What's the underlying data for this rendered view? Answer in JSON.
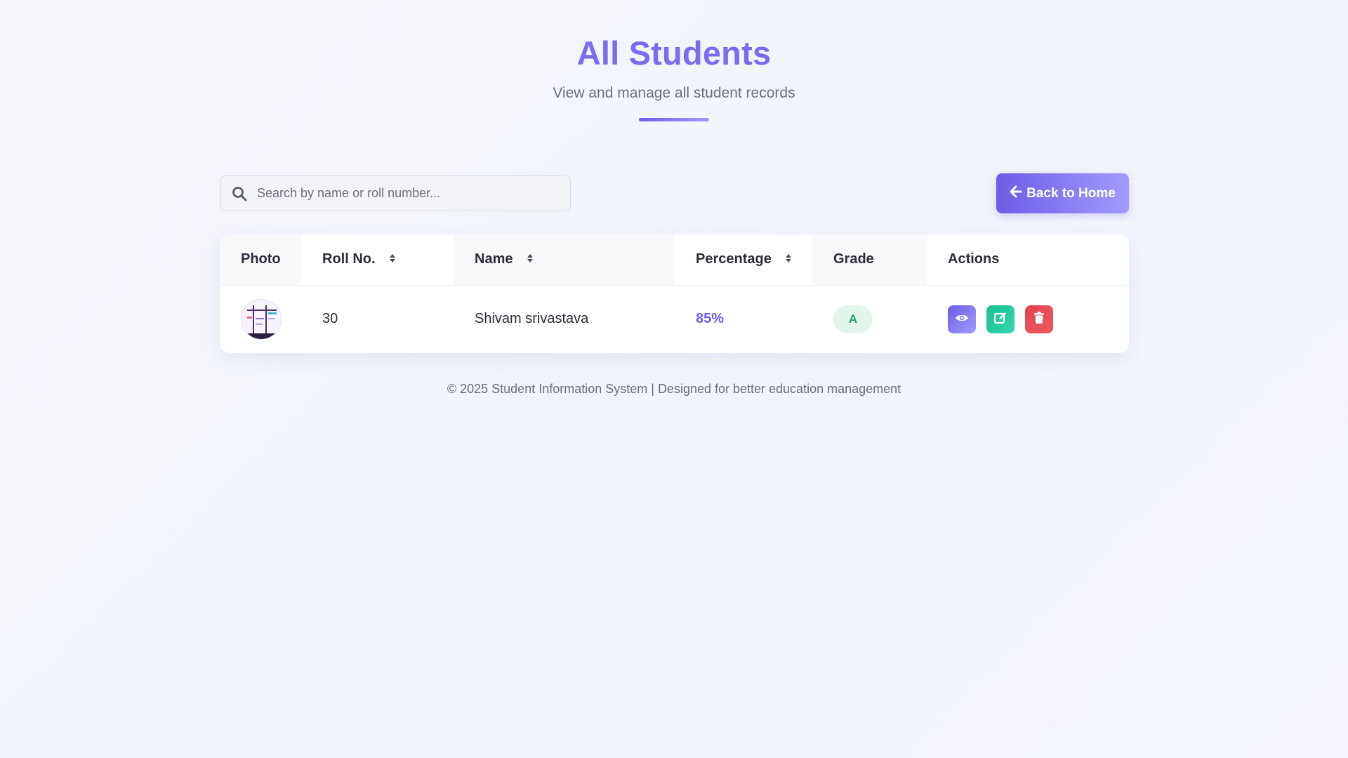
{
  "header": {
    "title": "All Students",
    "subtitle": "View and manage all student records"
  },
  "search": {
    "placeholder": "Search by name or roll number...",
    "value": ""
  },
  "back_button": {
    "label": "Back to Home"
  },
  "table": {
    "columns": [
      "Photo",
      "Roll No.",
      "Name",
      "Percentage",
      "Grade",
      "Actions"
    ],
    "rows": [
      {
        "roll": "30",
        "name": "Shivam srivastava",
        "percentage": "85%",
        "grade": "A"
      }
    ]
  },
  "footer": {
    "text": "© 2025 Student Information System | Designed for better education management"
  },
  "colors": {
    "accent": "#6c5ce7",
    "accent_light": "#a29bfe",
    "edit": "#1fbf8f",
    "delete": "#e2434b",
    "grade_bg": "#e3f6ec",
    "grade_text": "#27a160"
  },
  "icons": {
    "search": "search-icon",
    "back": "arrow-left-icon",
    "sort": "sort-icon",
    "view": "eye-icon",
    "edit": "edit-icon",
    "delete": "trash-icon"
  }
}
